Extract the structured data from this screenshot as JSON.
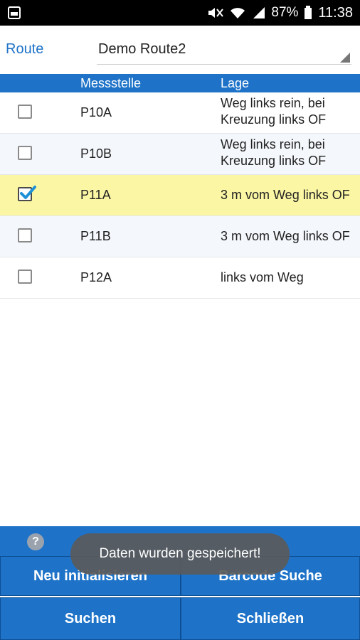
{
  "status_bar": {
    "battery": "87%",
    "time": "11:38",
    "icons": [
      "notification-image-icon",
      "mute-icon",
      "wifi-icon",
      "signal-icon",
      "battery-icon"
    ]
  },
  "route": {
    "label": "Route",
    "selected": "Demo Route2"
  },
  "table": {
    "headers": {
      "messstelle": "Messstelle",
      "lage": "Lage"
    },
    "rows": [
      {
        "messstelle": "P10A",
        "lage_line1": "Weg links rein, bei",
        "lage_line2": "Kreuzung links OF",
        "checked": false
      },
      {
        "messstelle": "P10B",
        "lage_line1": "Weg links rein, bei",
        "lage_line2": "Kreuzung links OF",
        "checked": false
      },
      {
        "messstelle": "P11A",
        "lage_line1": "3 m vom Weg links OF",
        "lage_line2": "",
        "checked": true
      },
      {
        "messstelle": "P11B",
        "lage_line1": "3 m vom Weg links OF",
        "lage_line2": "",
        "checked": false
      },
      {
        "messstelle": "P12A",
        "lage_line1": "links vom Weg",
        "lage_line2": "",
        "checked": false
      }
    ]
  },
  "bottom": {
    "help": "?",
    "buttons": {
      "neu": "Neu initialisieren",
      "barcode": "Barcode Suche",
      "suchen": "Suchen",
      "schliessen": "Schließen"
    }
  },
  "toast": "Daten wurden gespeichert!",
  "colors": {
    "accent": "#1e73c8",
    "selected_row": "#fbf6a4",
    "check": "#1e90d6"
  }
}
